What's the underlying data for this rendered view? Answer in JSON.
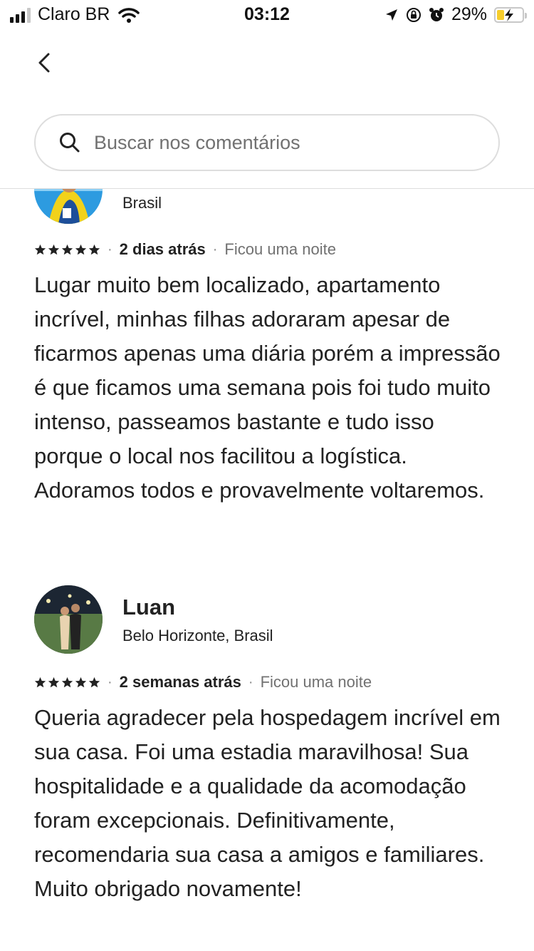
{
  "status_bar": {
    "carrier": "Claro BR",
    "time": "03:12",
    "battery_pct": "29%",
    "battery_level": 0.29,
    "icons": [
      "signal-icon",
      "wifi-icon",
      "location-arrow-icon",
      "orientation-lock-icon",
      "alarm-icon",
      "battery-charging-icon"
    ]
  },
  "header": {
    "back_icon": "chevron-left-icon",
    "search": {
      "placeholder": "Buscar nos comentários",
      "value": ""
    }
  },
  "reviews": [
    {
      "name": "",
      "location": "Brasil",
      "rating": 5,
      "when": "2 dias atrás",
      "stay": "Ficou uma noite",
      "text": "Lugar muito bem localizado, apartamento incrível, minhas filhas adoraram apesar de ficarmos apenas uma diária porém a impressão é que ficamos uma semana pois foi tudo muito intenso, passeamos bastante e tudo isso porque o local nos facilitou a logística. Adoramos todos e provavelmente voltaremos."
    },
    {
      "name": "Luan",
      "location": "Belo Horizonte, Brasil",
      "rating": 5,
      "when": "2 semanas atrás",
      "stay": "Ficou uma noite",
      "text": "Queria agradecer pela hospedagem incrível em sua casa. Foi uma estadia maravilhosa! Sua hospitalidade e a qualidade da acomodação foram excepcionais. Definitivamente, recomendaria sua casa a amigos e familiares. Muito obrigado novamente!"
    }
  ],
  "colors": {
    "text": "#222222",
    "muted": "#717171",
    "border": "#dddddd",
    "battery": "#f6cd2b"
  }
}
